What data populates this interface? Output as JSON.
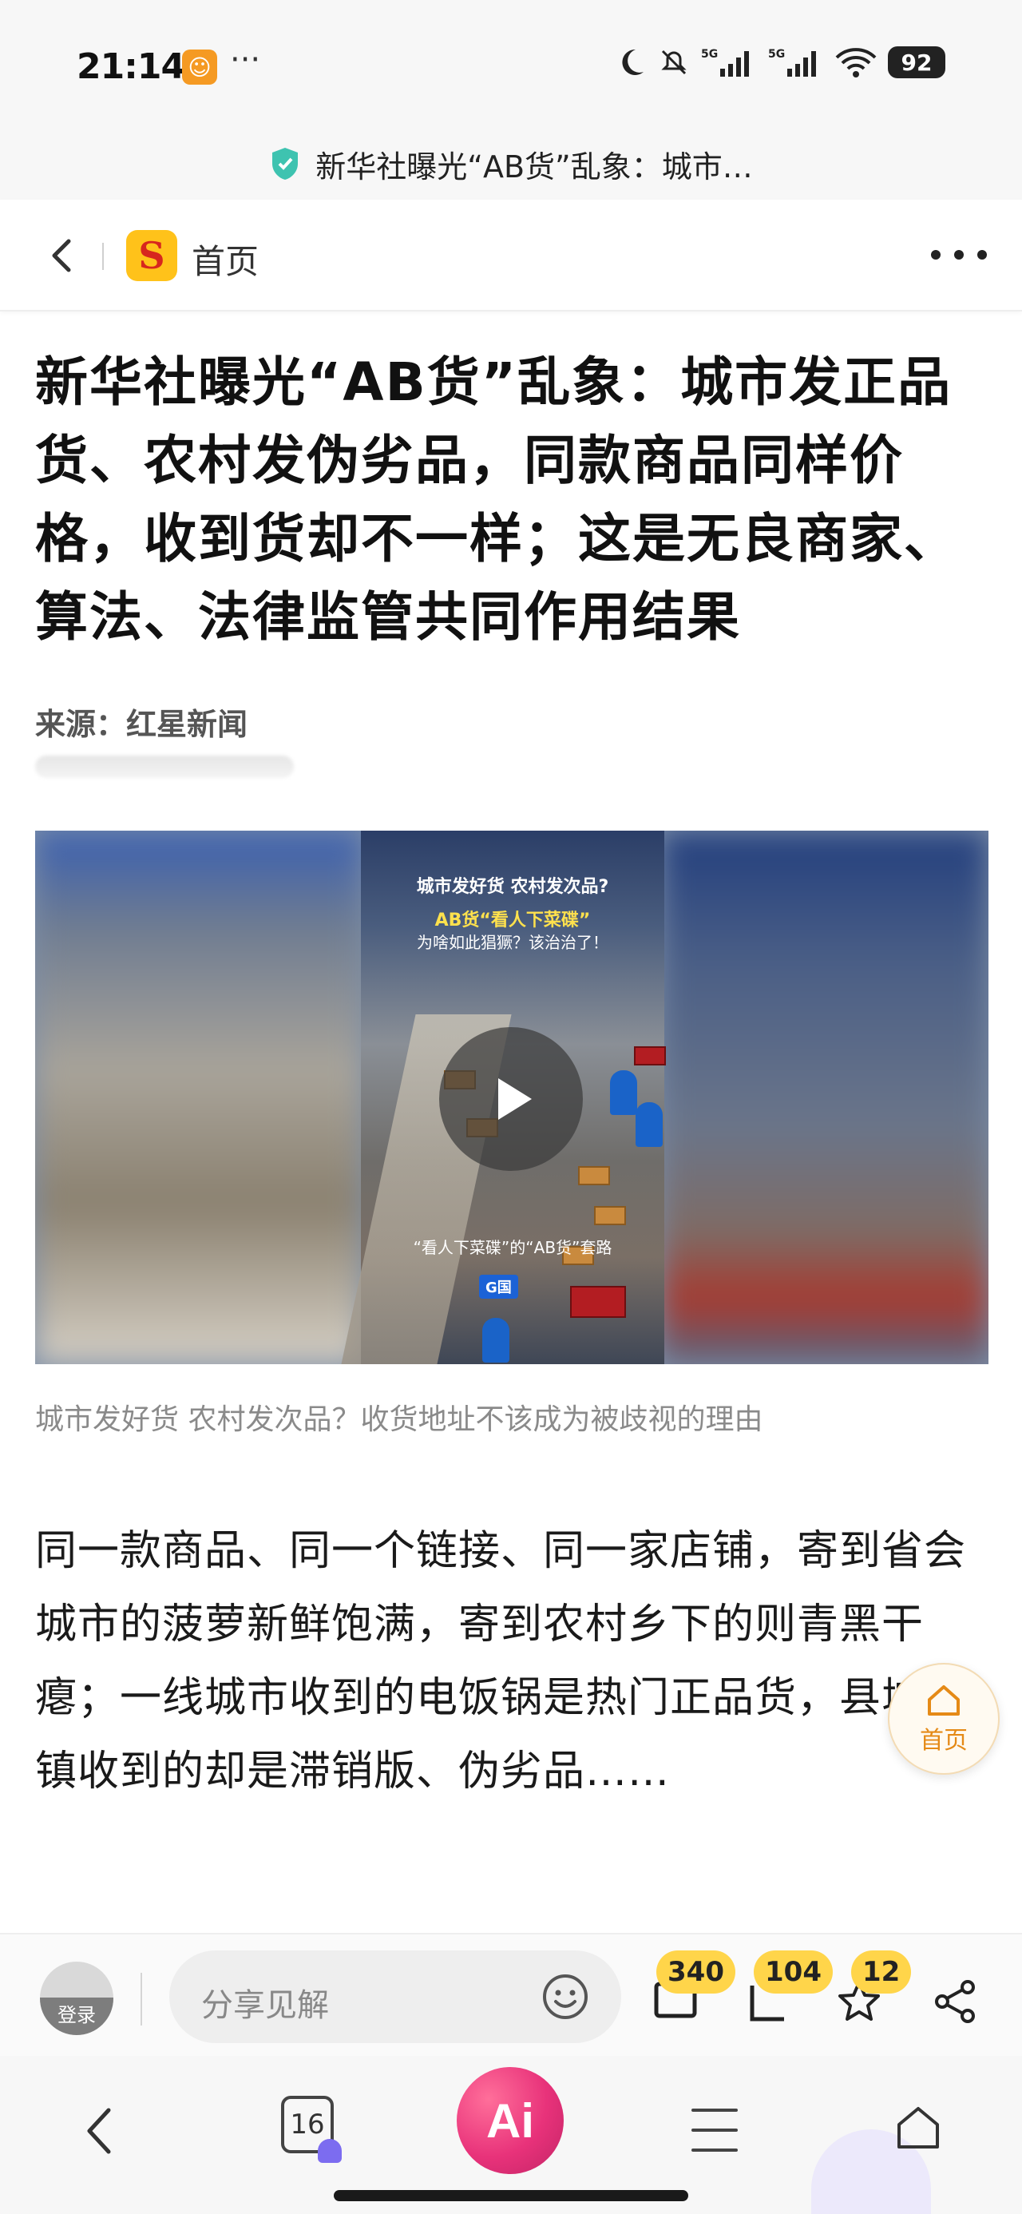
{
  "status_bar": {
    "time": "21:14",
    "dots": "···",
    "battery": "92",
    "network": "5G"
  },
  "url_bar": {
    "text": "新华社曝光“AB货”乱象：城市…"
  },
  "nav": {
    "home_label": "首页",
    "logo_letter": "S"
  },
  "article": {
    "title": "新华社曝光“AB货”乱象：城市发正品货、农村发伪劣品，同款商品同样价格，收到货却不一样；这是无良商家、算法、法律监管共同作用结果",
    "source": "来源：红星新闻",
    "video": {
      "caption_line1": "城市发好货 农村发次品?",
      "caption_line2": "AB货“看人下菜碟”",
      "caption_line3": "为啥如此猖獗？该治治了！",
      "subtitle": "“看人下菜碟”的“AB货”套路",
      "badge": "G国"
    },
    "video_description": "城市发好货 农村发次品？收货地址不该成为被歧视的理由",
    "body": "同一款商品、同一个链接、同一家店铺，寄到省会城市的菠萝新鲜饱满，寄到农村乡下的则青黑干瘪；一线城市收到的电饭锅是热门正品货，县城乡镇收到的却是滞销版、伪劣品……"
  },
  "float_home": {
    "label": "首页"
  },
  "comment_bar": {
    "login_label": "登录",
    "placeholder": "分享见解",
    "comment_count": "340",
    "bookmark_count": "104",
    "star_count": "12"
  },
  "bottom_bar": {
    "tabs_count": "16",
    "ai_label": "Ai"
  }
}
